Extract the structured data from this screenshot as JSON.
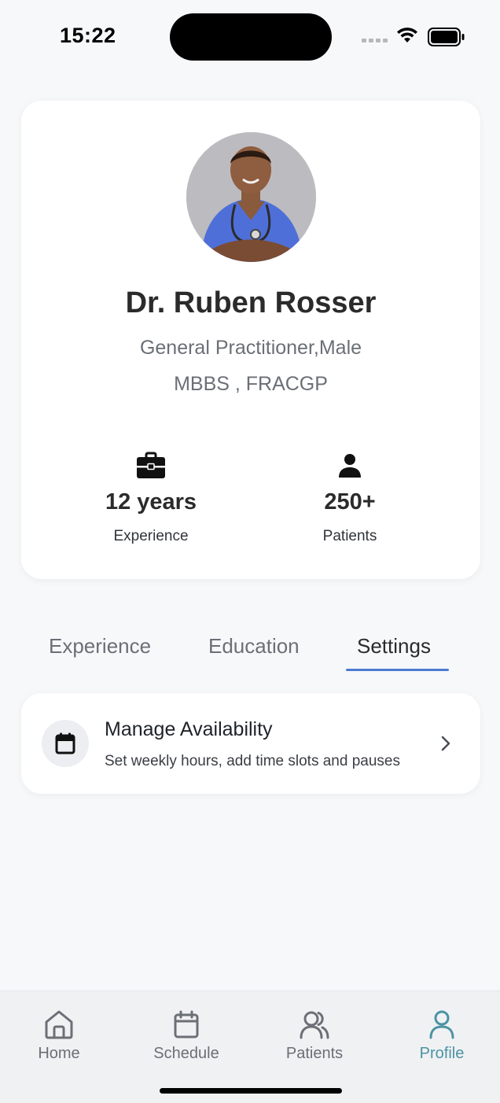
{
  "status_bar": {
    "time": "15:22"
  },
  "profile": {
    "name": "Dr. Ruben Rosser",
    "specialty": "General Practitioner,Male",
    "qualifications": "MBBS , FRACGP",
    "avatar_icon": "doctor-photo",
    "stats": [
      {
        "icon": "briefcase-icon",
        "value": "12 years",
        "label": "Experience"
      },
      {
        "icon": "person-icon",
        "value": "250+",
        "label": "Patients"
      }
    ]
  },
  "tabs": [
    {
      "label": "Experience",
      "active": false
    },
    {
      "label": "Education",
      "active": false
    },
    {
      "label": "Settings",
      "active": true
    }
  ],
  "settings": {
    "items": [
      {
        "icon": "calendar-icon",
        "title": "Manage Availability",
        "subtitle": "Set weekly hours, add time slots and pauses"
      }
    ]
  },
  "bottom_nav": {
    "items": [
      {
        "icon": "home-icon",
        "label": "Home",
        "active": false
      },
      {
        "icon": "calendar-icon",
        "label": "Schedule",
        "active": false
      },
      {
        "icon": "users-icon",
        "label": "Patients",
        "active": false
      },
      {
        "icon": "user-icon",
        "label": "Profile",
        "active": true
      }
    ]
  },
  "colors": {
    "accent": "#4a7bd0",
    "active_nav": "#4b93a3",
    "background": "#f7f8fa"
  }
}
